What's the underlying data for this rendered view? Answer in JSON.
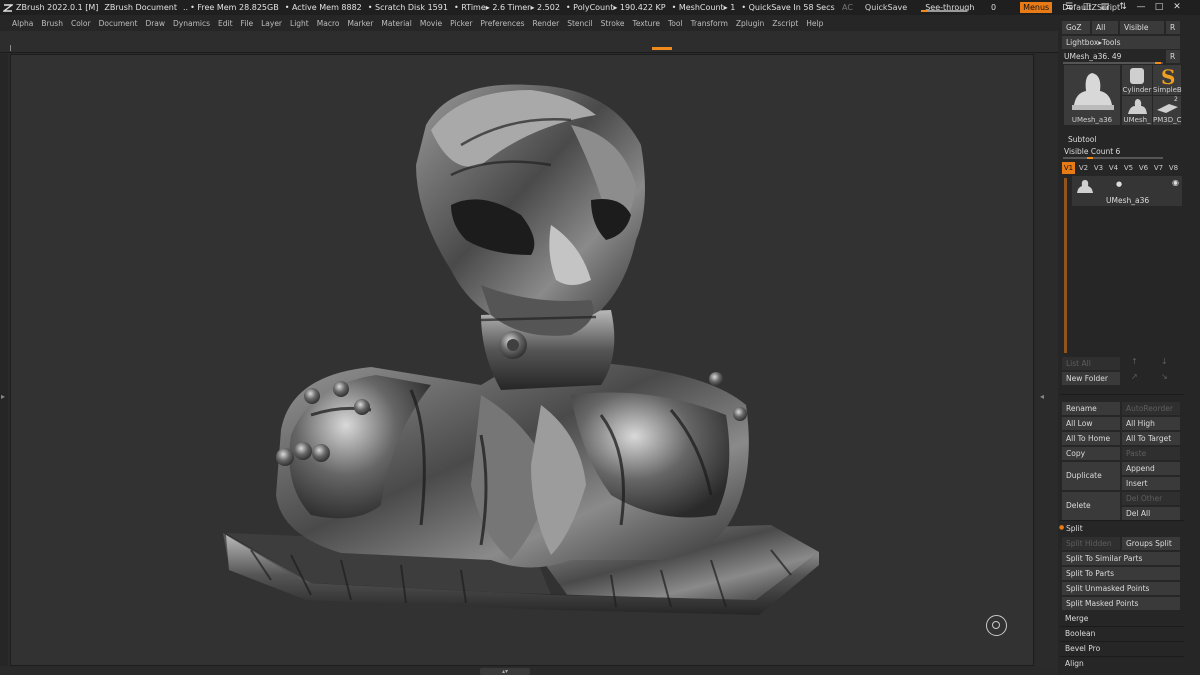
{
  "titlebar": {
    "app": "ZBrush 2022.0.1 [M]",
    "document": "ZBrush Document",
    "dots": "..",
    "free_mem": "• Free Mem 28.825GB",
    "active_mem": "• Active Mem 8882",
    "scratch": "• Scratch Disk 1591",
    "rtime": "• RTime▸ 2.6 Timer▸ 2.502",
    "polycount": "• PolyCount▸ 190.422 KP",
    "meshcount": "• MeshCount▸ 1",
    "quicksave_in": "• QuickSave In 58 Secs",
    "ac": "AC",
    "quicksave": "QuickSave",
    "seethrough": "See-through",
    "seethrough_value": "0",
    "menus": "Menus",
    "script": "DefaultZScript"
  },
  "menubar": {
    "items": [
      "Alpha",
      "Brush",
      "Color",
      "Document",
      "Draw",
      "Dynamics",
      "Edit",
      "File",
      "Layer",
      "Light",
      "Macro",
      "Marker",
      "Material",
      "Movie",
      "Picker",
      "Preferences",
      "Render",
      "Stencil",
      "Stroke",
      "Texture",
      "Tool",
      "Transform",
      "Zplugin",
      "Zscript",
      "Help"
    ]
  },
  "panel": {
    "goz": "GoZ",
    "all": "All",
    "visible": "Visible",
    "r": "R",
    "lightbox_tools": "Lightbox▸Tools",
    "current_tool": "UMesh_a36. 49",
    "r2": "R",
    "tools": [
      {
        "name": "UMesh_a36"
      },
      {
        "name": "Cylinder"
      },
      {
        "name": "SimpleB"
      },
      {
        "name": "UMesh_"
      },
      {
        "name": "PM3D_C"
      }
    ],
    "tool_count": "2",
    "subtool_header": "Subtool",
    "visible_count": "Visible Count 6",
    "vtabs": [
      "V1",
      "V2",
      "V3",
      "V4",
      "V5",
      "V6",
      "V7",
      "V8"
    ],
    "subtool_name": "UMesh_a36",
    "list_all": "List All",
    "new_folder": "New Folder",
    "rename": "Rename",
    "autoreorder": "AutoReorder",
    "all_low": "All Low",
    "all_high": "All High",
    "all_to_home": "All To Home",
    "all_to_target": "All To Target",
    "copy": "Copy",
    "paste": "Paste",
    "duplicate": "Duplicate",
    "append": "Append",
    "insert": "Insert",
    "delete": "Delete",
    "del_other": "Del Other",
    "del_all": "Del All",
    "split_header": "Split",
    "split_hidden": "Split Hidden",
    "groups_split": "Groups Split",
    "split_to_similar": "Split To Similar Parts",
    "split_to_parts": "Split To Parts",
    "split_unmasked": "Split Unmasked Points",
    "split_masked": "Split Masked Points",
    "merge": "Merge",
    "boolean": "Boolean",
    "bevel_pro": "Bevel Pro",
    "align": "Align"
  },
  "colors": {
    "accent": "#e87b16",
    "panel_bg": "#262626",
    "canvas_bg": "#323232"
  }
}
